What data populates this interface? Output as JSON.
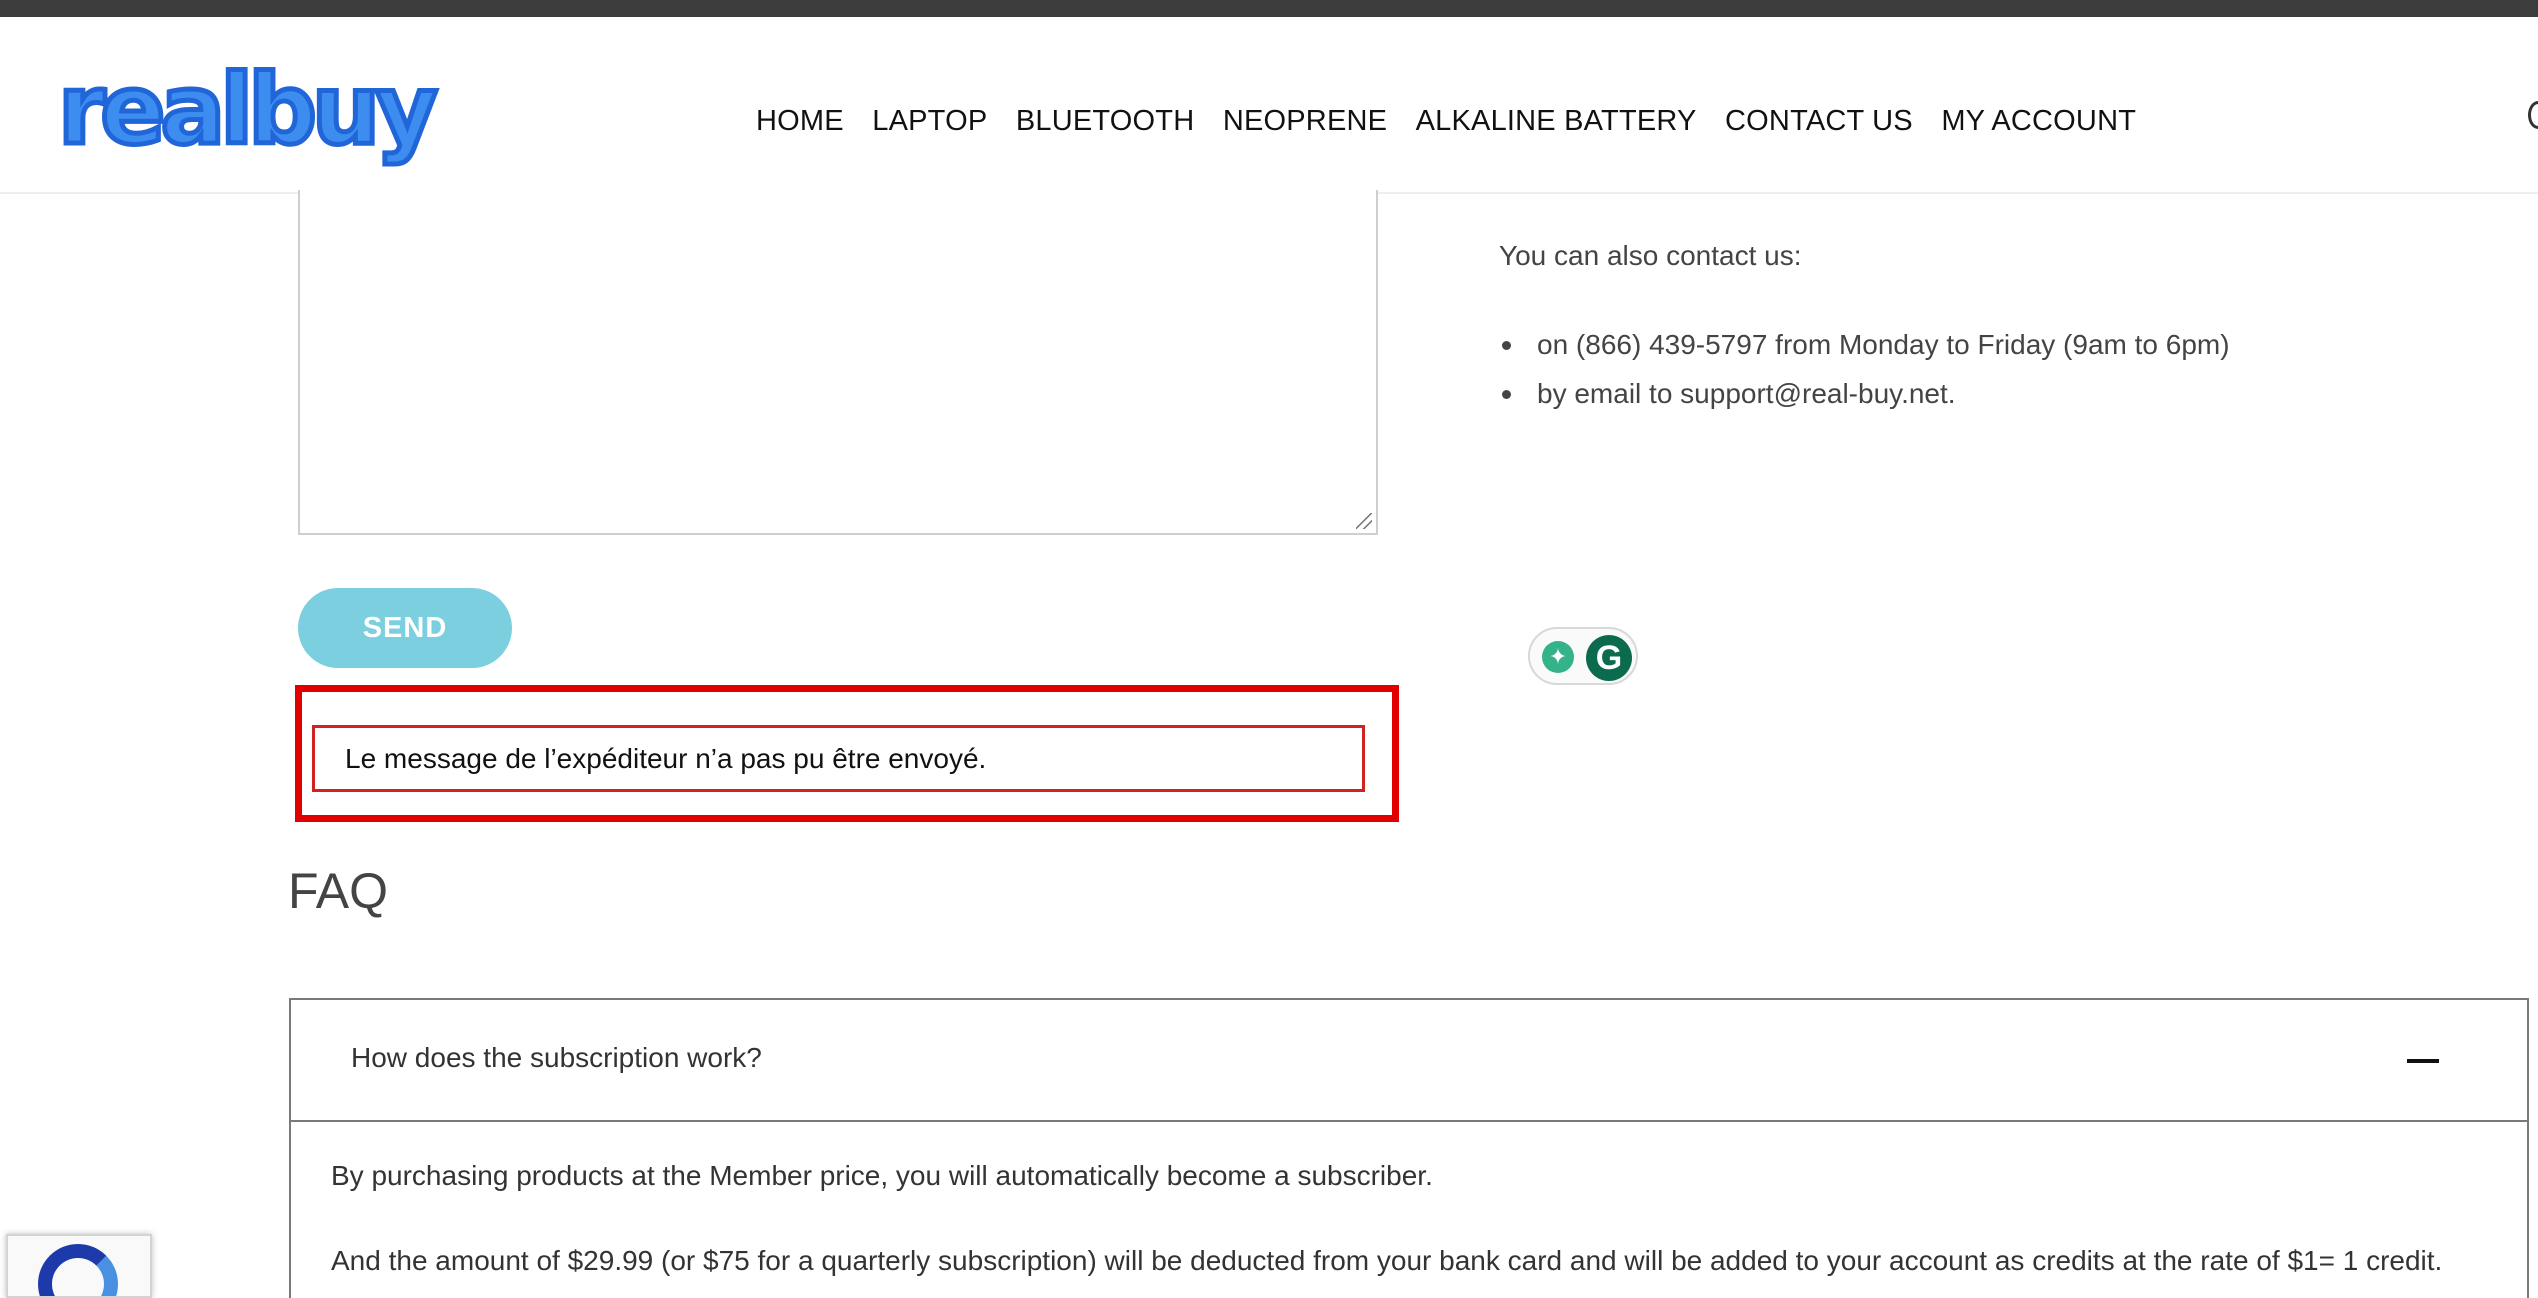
{
  "header": {
    "logo_text": "realbuy",
    "nav": [
      "HOME",
      "LAPTOP",
      "BLUETOOTH",
      "NEOPRENE",
      "ALKALINE BATTERY",
      "CONTACT US",
      "MY ACCOUNT"
    ]
  },
  "form": {
    "message_value": "",
    "send_label": "SEND",
    "error_message": "Le message de l’expéditeur n’a pas pu être envoyé."
  },
  "contact": {
    "intro": "You can also contact us:",
    "items": [
      "on (866) 439-5797 from Monday to Friday (9am to 6pm)",
      "by email to support@real-buy.net."
    ]
  },
  "faq": {
    "title": "FAQ",
    "items": [
      {
        "question": "How does the subscription work?",
        "answer_lines": [
          "By purchasing products at the Member price, you will automatically become a subscriber.",
          "And the amount of $29.99 (or $75 for a quarterly subscription) will be deducted from your bank card and will be added to your account as credits at the rate of $1= 1 credit."
        ]
      }
    ]
  },
  "colors": {
    "send_button": "#7ccfdf",
    "highlight_border": "#e00000",
    "error_border": "#d32020",
    "topbar": "#3c3c3c",
    "logo_blue": "#3d8cf0"
  },
  "icons": {
    "grammarly_bulb": "lightbulb-icon",
    "grammarly_logo": "grammarly-g-icon",
    "faq_toggle": "minus-icon",
    "recaptcha": "recaptcha-icon"
  }
}
